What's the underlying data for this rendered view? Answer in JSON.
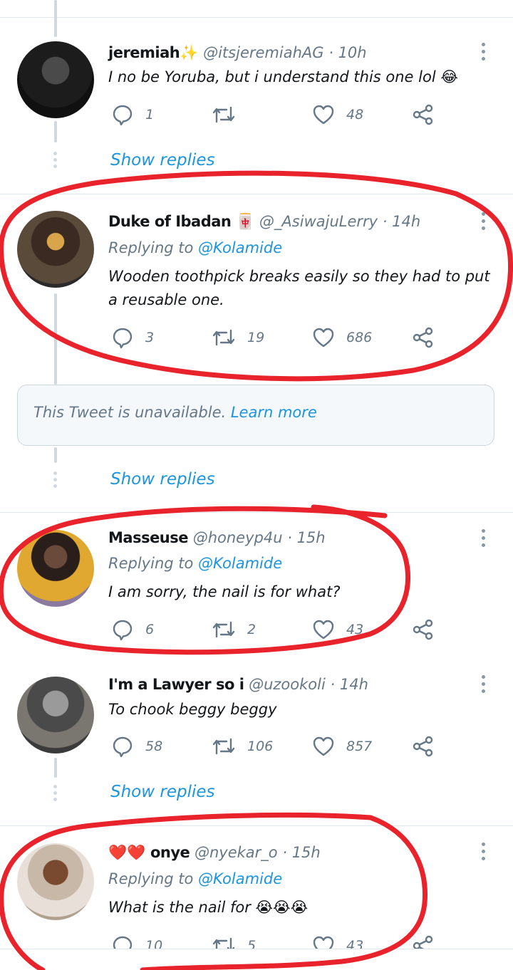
{
  "tweets": [
    {
      "name": "jeremiah",
      "name_emoji": "✨",
      "handle": "@itsjeremiahAG",
      "time": "· 10h",
      "replying_prefix": "",
      "replying_to": "",
      "text": "I no be Yoruba, but i understand this one lol 😂",
      "replies": "1",
      "retweets": "",
      "likes": "48"
    },
    {
      "name": "Duke of Ibadan",
      "name_emoji": "🀄",
      "handle": "@_AsiwajuLerry",
      "time": "· 14h",
      "replying_prefix": "Replying to",
      "replying_to": "@Kolamide",
      "text": "Wooden toothpick breaks easily so they had to put a reusable one.",
      "replies": "3",
      "retweets": "19",
      "likes": "686"
    },
    {
      "name": "Masseuse",
      "name_emoji": "",
      "handle": "@honeyp4u",
      "time": "· 15h",
      "replying_prefix": "Replying to",
      "replying_to": "@Kolamide",
      "text": "I am sorry, the nail is for what?",
      "replies": "6",
      "retweets": "2",
      "likes": "43"
    },
    {
      "name": "I'm a Lawyer so i",
      "name_emoji": "",
      "handle": "@uzookoli",
      "time": "· 14h",
      "replying_prefix": "",
      "replying_to": "",
      "text": "To chook beggy beggy",
      "replies": "58",
      "retweets": "106",
      "likes": "857"
    },
    {
      "name": "onye",
      "name_emoji": "❤️❤️",
      "handle": "@nyekar_o",
      "time": "· 15h",
      "replying_prefix": "Replying to",
      "replying_to": "@Kolamide",
      "text": "What is the nail for 😭😭😭",
      "replies": "10",
      "retweets": "5",
      "likes": "43"
    }
  ],
  "show_replies_label": "Show replies",
  "unavailable": {
    "text": "This Tweet is unavailable.",
    "link": "Learn more"
  },
  "colors": {
    "accent": "#1b95e0",
    "muted": "#657786",
    "annotation": "#e8232b"
  }
}
